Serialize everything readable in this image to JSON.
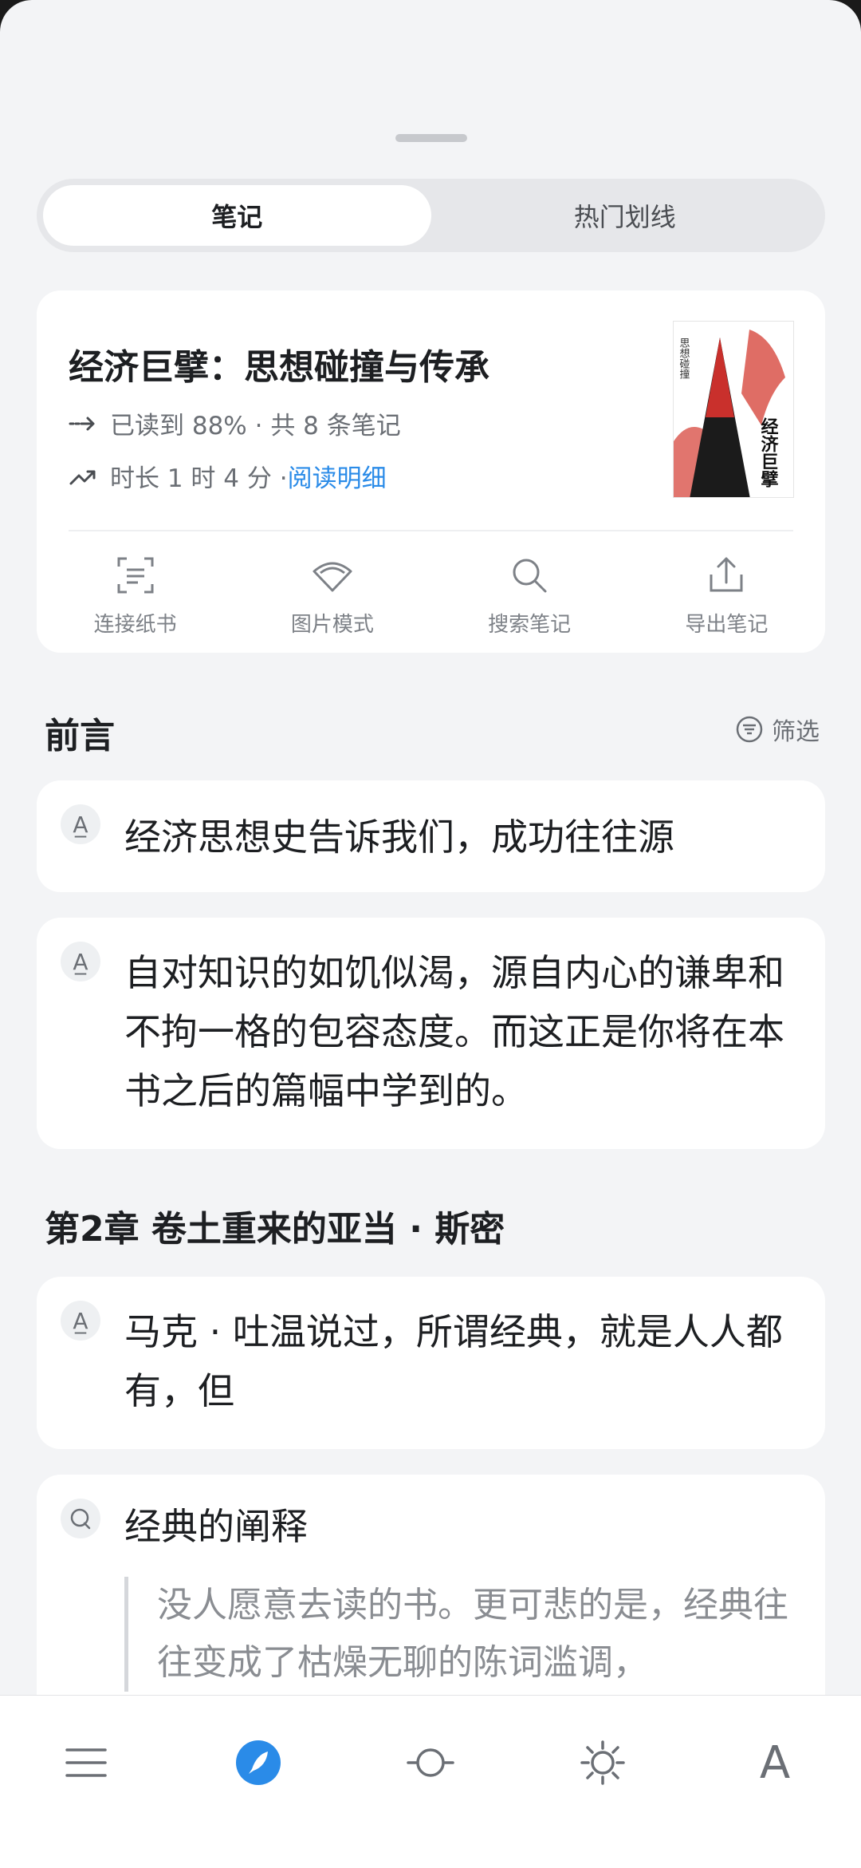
{
  "tabs": [
    {
      "label": "笔记",
      "active": true
    },
    {
      "label": "热门划线",
      "active": false
    }
  ],
  "book": {
    "title": "经济巨擘：思想碰撞与传承",
    "progress_text": "已读到 88% · 共 8 条笔记",
    "duration_text": "时长 1 时 4 分 · ",
    "detail_link": "阅读明细",
    "cover_title_cn": "经济巨擘",
    "cover_side_text": "思想碰撞",
    "actions": [
      {
        "label": "连接纸书",
        "icon": "scan-icon"
      },
      {
        "label": "图片模式",
        "icon": "fan-icon"
      },
      {
        "label": "搜索笔记",
        "icon": "search-icon"
      },
      {
        "label": "导出笔记",
        "icon": "export-icon"
      }
    ]
  },
  "sections": [
    {
      "title": "前言"
    },
    {
      "title": "第2章 卷土重来的亚当 · 斯密"
    }
  ],
  "filter_label": "筛选",
  "notes": [
    {
      "type": "highlight",
      "text": "经济思想史告诉我们，成功往往源"
    },
    {
      "type": "highlight",
      "text": "自对知识的如饥似渴，源自内心的谦卑和不拘一格的包容态度。而这正是你将在本书之后的篇幅中学到的。"
    },
    {
      "type": "highlight",
      "text": "马克 · 吐温说过，所谓经典，就是人人都有，但"
    },
    {
      "type": "thought",
      "text": "经典的阐释",
      "quote": "没人愿意去读的书。更可悲的是，经典往往变成了枯燥无聊的陈词滥调，"
    }
  ],
  "bottom_tabs": [
    "menu-icon",
    "compass-icon",
    "circle-slider-icon",
    "brightness-icon",
    "font-icon"
  ],
  "font_letter": "A",
  "colors": {
    "accent": "#2a8be8",
    "background": "#f3f4f6"
  }
}
